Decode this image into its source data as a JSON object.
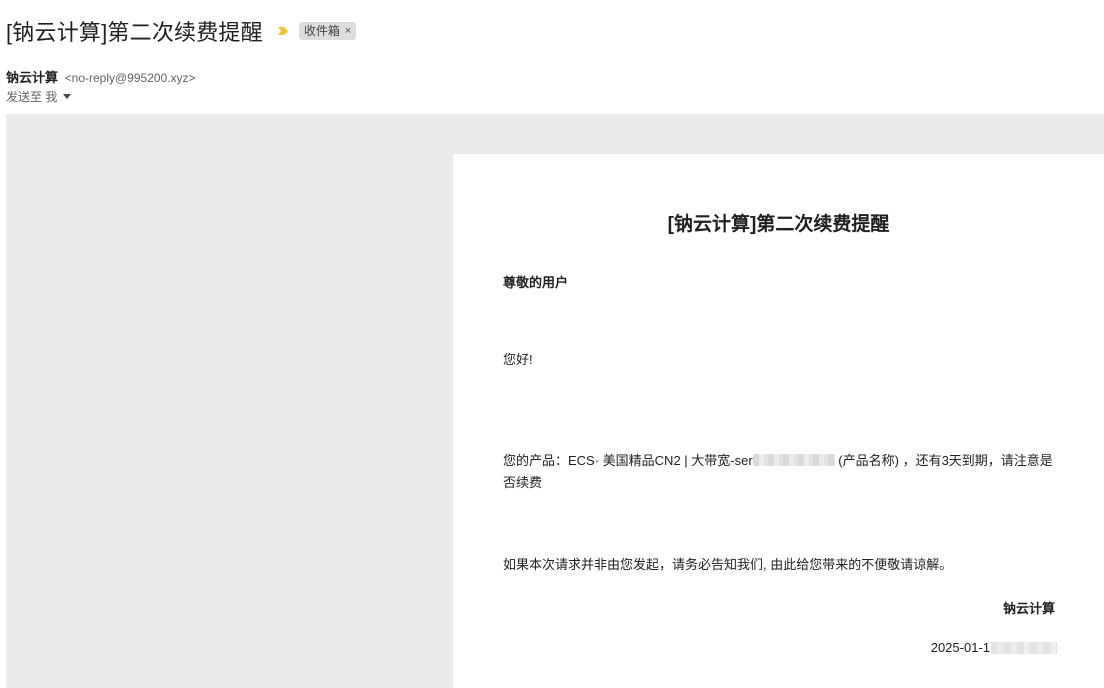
{
  "email": {
    "subject": "[钠云计算]第二次续费提醒",
    "label": "收件箱",
    "label_remove": "×",
    "importance_color": "#f4c430",
    "sender_name": "钠云计算",
    "sender_email": "<no-reply@995200.xyz>",
    "recipient_text": "发送至 我"
  },
  "message": {
    "title": "[钠云计算]第二次续费提醒",
    "salutation": "尊敬的用户",
    "hello": "您好!",
    "product_prefix": "您的产品：ECS· 美国精品CN2 | 大带宽-ser",
    "product_suffix": "(产品名称) ，还有3天到期，请注意是否续费",
    "notice": "如果本次请求并非由您发起，请务必告知我们, 由此给您带来的不便敬请谅解。",
    "signature": "钠云计算",
    "date_prefix": "2025-01-1"
  },
  "colors": {
    "frame_bg": "#ebebeb",
    "card_bg": "#ffffff",
    "chip_bg": "#dddddd"
  }
}
